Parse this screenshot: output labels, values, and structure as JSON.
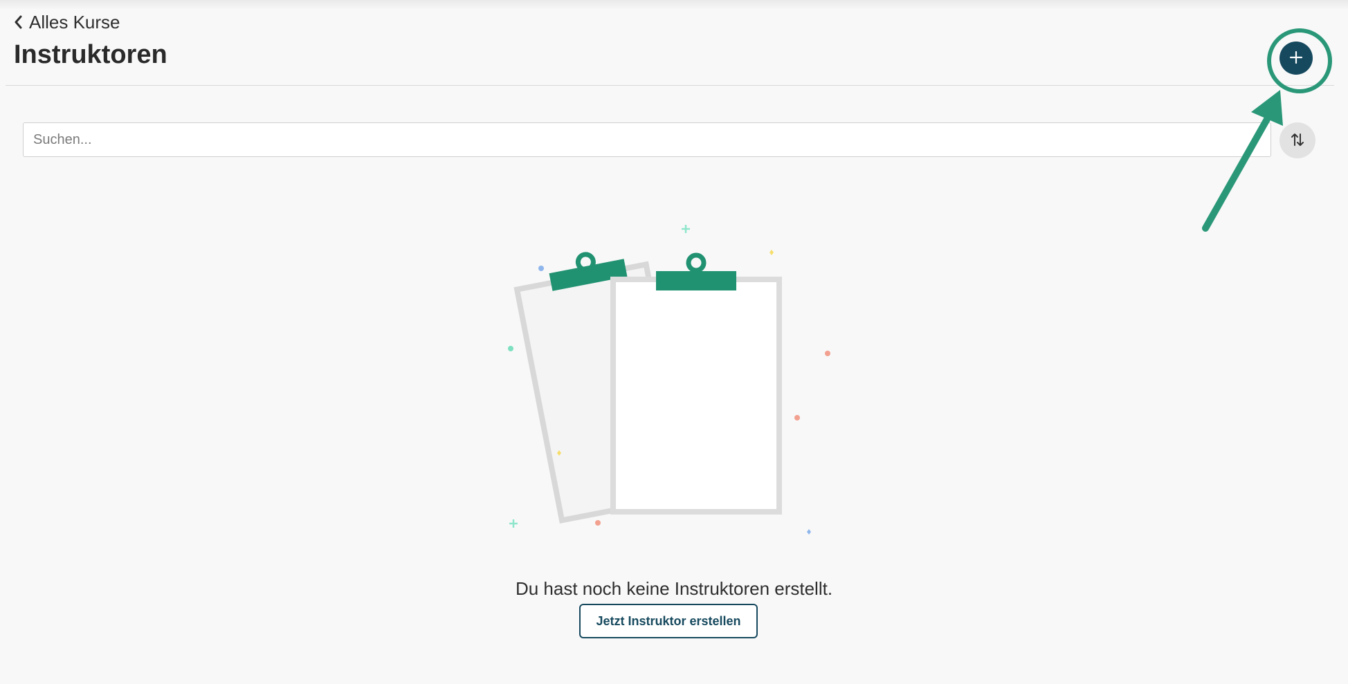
{
  "header": {
    "back_label": "Alles Kurse",
    "title": "Instruktoren"
  },
  "toolbar": {
    "add_icon": "plus-icon",
    "sort_icon": "sort-arrows-icon"
  },
  "search": {
    "placeholder": "Suchen...",
    "value": ""
  },
  "empty_state": {
    "illustration": "clipboard-illustration",
    "message": "Du hast noch keine Instruktoren erstellt.",
    "cta_label": "Jetzt Instruktor erstellen"
  },
  "annotation": {
    "highlight_color": "#2a9878"
  },
  "colors": {
    "primary": "#16495e",
    "accent": "#2a9878",
    "background": "#f8f8f8"
  }
}
